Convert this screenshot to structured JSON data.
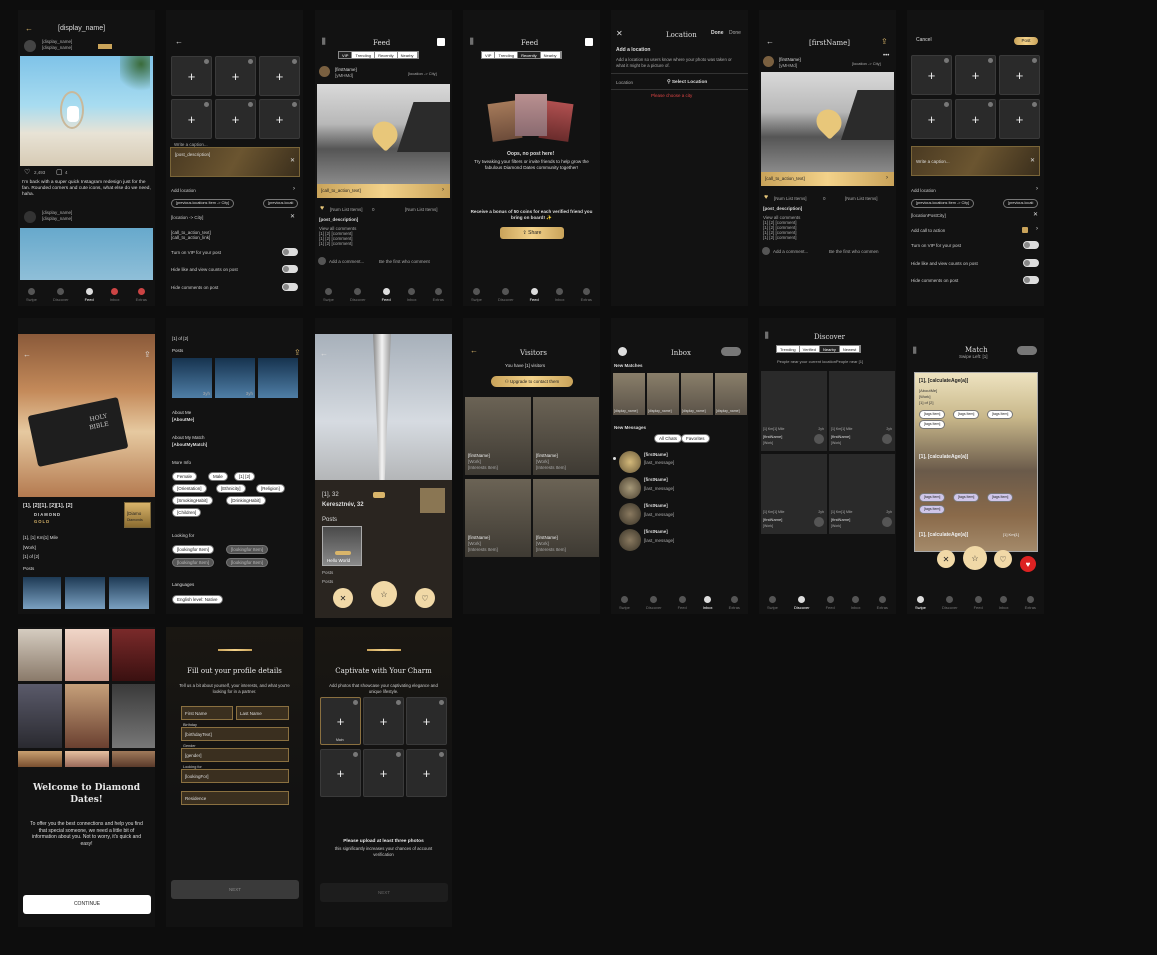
{
  "colors": {
    "gold": "#d9b56a",
    "bg": "#121212"
  },
  "s1": {
    "display_name": "[display_name]",
    "user_line1": "[display_name]",
    "user_line2": "[display_name]",
    "likes": "2,493",
    "comments": "4",
    "caption": "I'm back with a super quick Instagram redesign just for the fan. Rounded corners and cute icons, what else do we need, haha.",
    "user2_1": "[display_name]",
    "user2_2": "[display_name]",
    "nav": [
      "Swipe",
      "Discover",
      "Feed",
      "Inbox",
      "Extras"
    ]
  },
  "s2": {
    "write_caption": "Write a caption...",
    "post_description": "[post_description]",
    "add_location": "Add location",
    "chips": [
      "[previous.locations Item -> City]",
      "[previous.locati"
    ],
    "location_city": "[location -> City]",
    "call_to_action": "[call_to_action_text]",
    "call_to_action2": "[call_to_action_link]",
    "vip": "Turn on VIP for your post",
    "hide_likes": "Hide like and view counts on post",
    "hide_comments": "Hide comments on post"
  },
  "s3": {
    "title": "Feed",
    "tabs": [
      "VIP",
      "Trending",
      "Recently",
      "Nearby"
    ],
    "name": "[firstName]",
    "handle": "[yMHMd]",
    "location": "[location -> City]",
    "cta": "[call_to_action_text]",
    "num_list": "[Num List Items]",
    "zero": "0",
    "num_list2": "[Num List Items]",
    "post_description": "[post_description]",
    "view_all": "View all comments",
    "comments": [
      "[1] [2] [comment]",
      "[1] [2] [comment]",
      "[1] [2] [comment]"
    ],
    "add_comment": "Add a comment...",
    "first_comment": "Be the first who comment",
    "nav": [
      "Swipe",
      "Discover",
      "Feed",
      "Inbox",
      "Extras"
    ]
  },
  "s4": {
    "title": "Feed",
    "tabs": [
      "VIP",
      "Trending",
      "Recently",
      "Nearby"
    ],
    "oops": "Oops, no post here!",
    "message": "Try tweaking your filters or invite friends to help grow the fabulous Diamond Dates community together!",
    "bonus": "Receive a bonus of 50 coins for each verified friend you bring on board! ✨",
    "share": "Share",
    "nav": [
      "Swipe",
      "Discover",
      "Feed",
      "Inbox",
      "Extras"
    ]
  },
  "s5": {
    "title": "Location",
    "done": "Done",
    "done2": "Done",
    "add_location": "Add a location",
    "desc": "Add a location so users know where your photo was taken or what it might be a picture of.",
    "label": "Location",
    "select": "Select Location",
    "error": "Please choose a city"
  },
  "s6": {
    "title": "[firstName]",
    "name": "[firstName]",
    "handle": "[yMHMd]",
    "location": "[location -> City]",
    "cta": "[call_to_action_text]",
    "num_list": "[Num List Items]",
    "zero": "0",
    "num_list2": "[Num List Items]",
    "post_description": "[post_description]",
    "view_all": "View all comments",
    "comments": [
      "[1] [2] [comment]",
      "[1] [2] [comment]",
      "[1] [2] [comment]",
      "[1] [2] [comment]"
    ],
    "add_comment": "Add a comment...",
    "first_comment": "Be the first who commen"
  },
  "s7": {
    "cancel": "Cancel",
    "post": "Post",
    "write_caption": "Write a caption...",
    "add_location": "Add location",
    "chips": [
      "[previous.locations Item -> City]",
      "[previous.locati"
    ],
    "location_post": "[locationPostCity]",
    "add_cta": "Add call to action",
    "vip": "Turn on VIP for your post",
    "hide_likes": "Hide like and view counts on post",
    "hide_comments": "Hide comments on post"
  },
  "s8": {
    "name_line": "[1], [2][1], [2][1], [2]",
    "diamond": "DIAMOND",
    "gold": "GOLD",
    "badge": "[Diamo",
    "badge2": "Diamonds",
    "km": "[1], [1] Km[1] Mile",
    "work": "[Work]",
    "of": "[1] of [2]",
    "posts": "Posts",
    "bible1": "HOLY",
    "bible2": "BIBLE"
  },
  "s9": {
    "of": "[1] of [2]",
    "posts": "Posts",
    "about_me": "About Me",
    "about_me_val": "[AboutMe]",
    "about_match": "About My Match",
    "about_match_val": "[AboutMyMatch]",
    "more_info": "More Info",
    "chips": [
      "Female",
      "Male",
      "[1] [2]",
      "[Orientation]",
      "[Ethnicity]",
      "[Religion]",
      "[SmokingHabit]",
      "[DrinkingHabit]",
      "[Children]"
    ],
    "looking_for": "Looking for",
    "look_chips": [
      "[lookingfor Item]",
      "[lookingfor Item]",
      "[lookingfor Item]",
      "[lookingfor Item]"
    ],
    "languages": "Languages",
    "lang_chips": [
      "English level: Native"
    ],
    "thumb_labels": [
      "3yh",
      "3yh"
    ]
  },
  "s10": {
    "age": "[1], 32",
    "name": "Keresztnév, 32",
    "posts": "Posts",
    "hello": "Hello World",
    "posts2": "Posts",
    "posts3": "Posts"
  },
  "s11": {
    "title": "Visitors",
    "you_have": "You have [1] visitors",
    "upgrade": "Upgrade to contact them",
    "names": [
      "[firstName]",
      "[firstName]",
      "[firstName]",
      "[firstName]",
      "[firstName]",
      "[firstName]"
    ],
    "small": "[Work]",
    "tag": "[Interests Item]"
  },
  "s12": {
    "title": "Inbox",
    "new_matches": "New Matches",
    "match_names": [
      "[display_name]",
      "[display_name]",
      "[display_name]",
      "[display_name]"
    ],
    "new_messages": "New Messages",
    "all_chats": "All Chats",
    "favorites": "Favorites",
    "chat_names": [
      "[firstName]",
      "[firstName]",
      "[firstName]",
      "[firstName]"
    ],
    "last_msg": "[last_message]",
    "nav": [
      "Swipe",
      "Discover",
      "Feed",
      "Inbox",
      "Extras"
    ]
  },
  "s13": {
    "title": "Discover",
    "tabs": [
      "Trending",
      "Verified",
      "Nearby",
      "Newest"
    ],
    "people_near": "People near your current locationPeople near [1]",
    "km": "[1] Km[1] Mile",
    "name": "[firstName]",
    "work": "[Work]",
    "nav": [
      "Swipe",
      "Discover",
      "Feed",
      "Inbox",
      "Extras"
    ],
    "dist": "2yh"
  },
  "s14": {
    "title": "Match",
    "swipe_left": "Swipe Left: [1]",
    "calc1": "[1], [calculateAge(a)]",
    "about": "[AboutMe]",
    "work": "[Work]",
    "of": "[1] of [2]",
    "tags": [
      "[tags Item]",
      "[tags Item]",
      "[tags Item]",
      "[tags Item]"
    ],
    "calc2": "[1], [calculateAge(a)]",
    "calc3": "[1], [calculateAge(a)]",
    "km": "[1] Km[1]",
    "nav": [
      "Swipe",
      "Discover",
      "Feed",
      "Inbox",
      "Extras"
    ]
  },
  "s15": {
    "title": "Welcome to Diamond Dates!",
    "body": "To offer you the best connections and help you find that special someone, we need a little bit of information about you. Not to worry, it's quick and easy!",
    "continue": "CONTINUE"
  },
  "s16": {
    "title": "Fill out your profile details",
    "subtitle": "Tell us a bit about yourself, your interests, and what you're looking for in a partner.",
    "first": "First Name",
    "last": "Last Name",
    "birthday_label": "Birthday",
    "birthday": "[birthdayText]",
    "gender_label": "Gender",
    "gender": "[gender]",
    "looking_label": "Looking for",
    "looking": "[lookingFor]",
    "residence": "Residence",
    "next": "NEXT"
  },
  "s17": {
    "title": "Captivate with Your Charm",
    "subtitle": "Add photos that showcase your captivating elegance and unique lifestyle.",
    "main": "Main",
    "please": "Please upload at least three photos",
    "increase": "this significantly increases your chances of account verification",
    "next": "NEXT"
  }
}
